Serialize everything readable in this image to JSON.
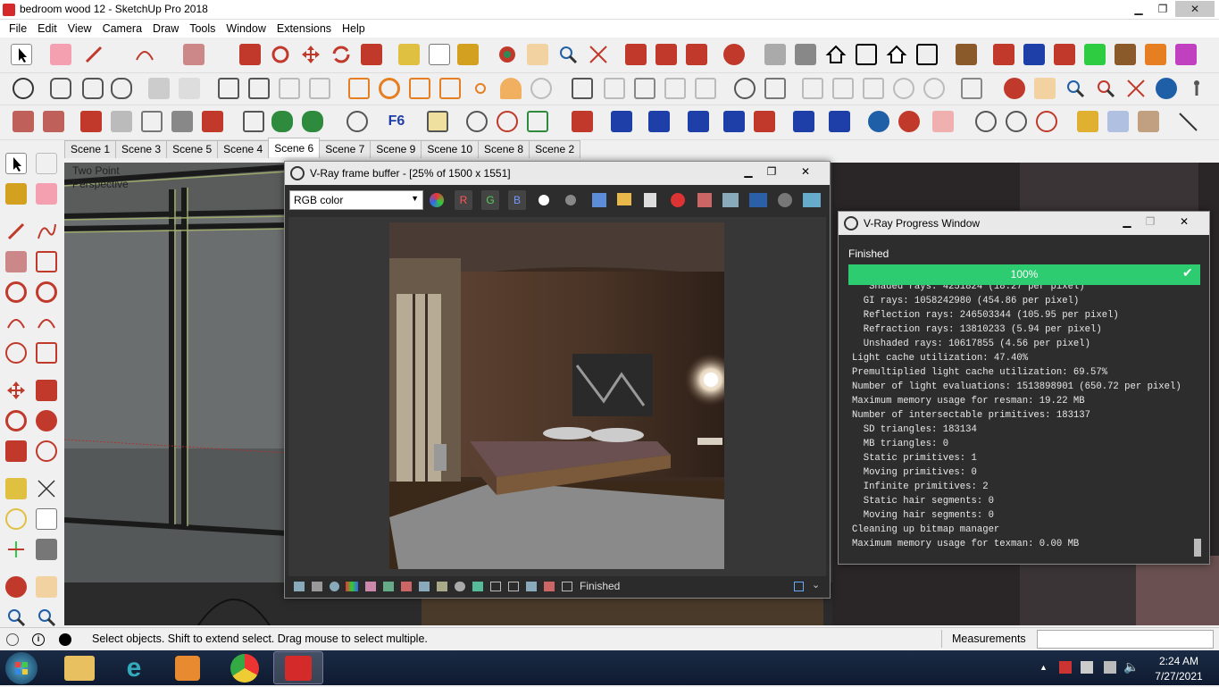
{
  "window": {
    "title": "bedroom wood 12 - SketchUp Pro 2018",
    "btn_minimize": "▁",
    "btn_restore": "❐",
    "btn_close": "✕"
  },
  "menu": [
    "File",
    "Edit",
    "View",
    "Camera",
    "Draw",
    "Tools",
    "Window",
    "Extensions",
    "Help"
  ],
  "scene_tabs": [
    {
      "label": "Scene 1",
      "active": false
    },
    {
      "label": "Scene 3",
      "active": false
    },
    {
      "label": "Scene 5",
      "active": false
    },
    {
      "label": "Scene 4",
      "active": false
    },
    {
      "label": "Scene 6",
      "active": true
    },
    {
      "label": "Scene 7",
      "active": false
    },
    {
      "label": "Scene 9",
      "active": false
    },
    {
      "label": "Scene 10",
      "active": false
    },
    {
      "label": "Scene 8",
      "active": false
    },
    {
      "label": "Scene 2",
      "active": false
    }
  ],
  "viewport": {
    "camera_label": "Two Point\nPerspective"
  },
  "vfb": {
    "title": "V-Ray frame buffer - [25% of 1500 x 1551]",
    "channel": "RGB color",
    "btn_r": "R",
    "btn_g": "G",
    "btn_b": "B",
    "status": "Finished"
  },
  "progress": {
    "title": "V-Ray Progress Window",
    "status": "Finished",
    "percent": 1.0,
    "percent_label": "100%",
    "log_partial": "   Shaded rays: 4251824 (18.27 per pixel)",
    "log": [
      "  GI rays: 1058242980 (454.86 per pixel)",
      "  Reflection rays: 246503344 (105.95 per pixel)",
      "  Refraction rays: 13810233 (5.94 per pixel)",
      "  Unshaded rays: 10617855 (4.56 per pixel)",
      "Light cache utilization: 47.40%",
      "Premultiplied light cache utilization: 69.57%",
      "Number of light evaluations: 1513898901 (650.72 per pixel)",
      "Maximum memory usage for resman: 19.22 MB",
      "Number of intersectable primitives: 183137",
      "  SD triangles: 183134",
      "  MB triangles: 0",
      "  Static primitives: 1",
      "  Moving primitives: 0",
      "  Infinite primitives: 2",
      "  Static hair segments: 0",
      "  Moving hair segments: 0",
      "Cleaning up bitmap manager",
      "Maximum memory usage for texman: 0.00 MB"
    ]
  },
  "statusbar": {
    "hint": "Select objects. Shift to extend select. Drag mouse to select multiple.",
    "measurements_label": "Measurements",
    "measurements_value": ""
  },
  "taskbar": {
    "time": "2:24 AM",
    "date": "7/27/2021"
  },
  "colors": {
    "progress_green": "#2ecc71",
    "accent_red": "#d42a2a"
  }
}
